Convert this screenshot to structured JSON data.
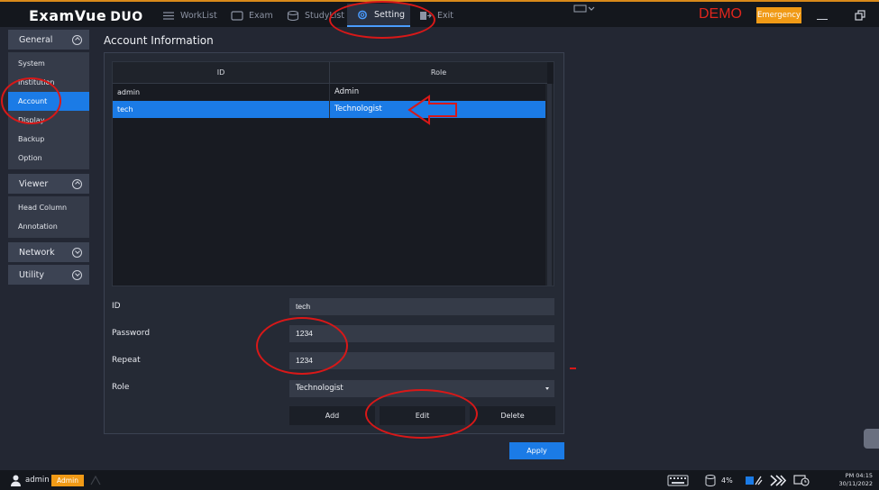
{
  "app": {
    "logo_main": "ExamVue",
    "logo_sub": "DUO",
    "demo_label": "DEMO",
    "emergency_label": "Emergency"
  },
  "nav": {
    "worklist": "WorkList",
    "exam": "Exam",
    "studylist": "StudyList",
    "setting": "Setting",
    "exit": "Exit"
  },
  "sidebar": {
    "general": {
      "label": "General",
      "items": [
        "System",
        "Institution",
        "Account",
        "Display",
        "Backup",
        "Option"
      ],
      "active": "Account"
    },
    "viewer": {
      "label": "Viewer",
      "items": [
        "Head Column",
        "Annotation"
      ]
    },
    "network": {
      "label": "Network"
    },
    "utility": {
      "label": "Utility"
    }
  },
  "main": {
    "title": "Account Information",
    "table": {
      "columns": [
        "ID",
        "Role"
      ],
      "rows": [
        {
          "id": "admin",
          "role": "Admin"
        },
        {
          "id": "tech",
          "role": "Technologist"
        }
      ],
      "selected_row": 1
    },
    "form": {
      "id_label": "ID",
      "id_value": "tech",
      "password_label": "Password",
      "password_value": "1234",
      "repeat_label": "Repeat",
      "repeat_value": "1234",
      "role_label": "Role",
      "role_value": "Technologist"
    },
    "buttons": {
      "add": "Add",
      "edit": "Edit",
      "delete": "Delete",
      "apply": "Apply"
    }
  },
  "status": {
    "user": "admin",
    "user_role": "Admin",
    "disk_usage": "4%",
    "time": "PM 04:15",
    "date": "30/11/2022"
  },
  "colors": {
    "accent": "#1b7be6",
    "emergency": "#f09a16",
    "demo": "#e0261d",
    "annotation": "#d81818"
  }
}
